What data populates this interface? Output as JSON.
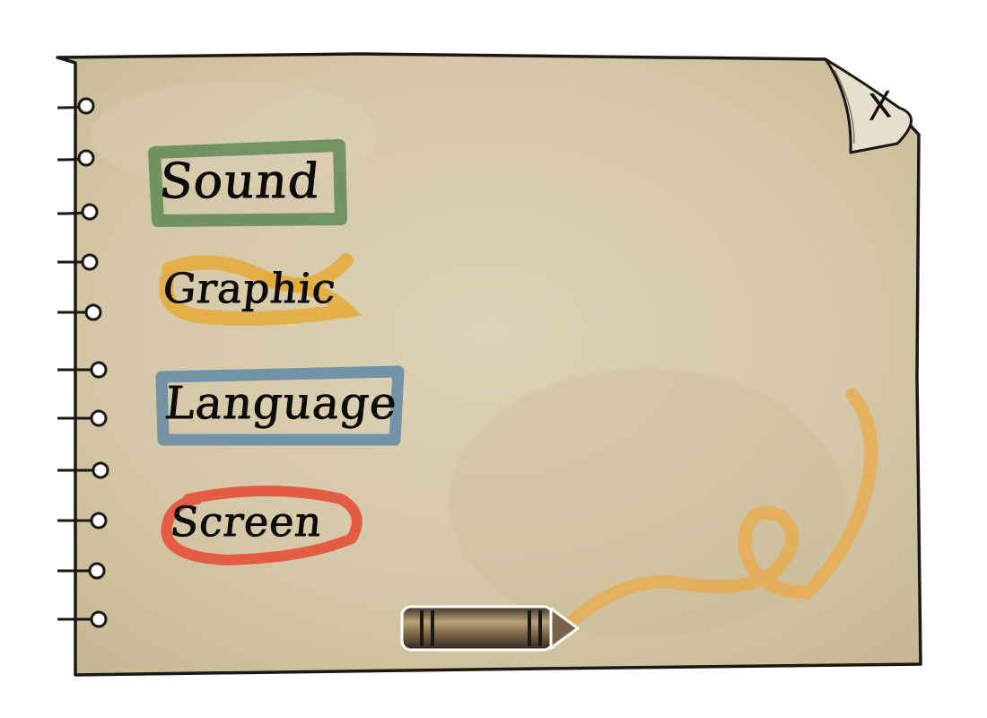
{
  "menu": {
    "items": [
      {
        "label": "Sound",
        "highlight": "green-box"
      },
      {
        "label": "Graphic",
        "highlight": "yellow-swoosh"
      },
      {
        "label": "Language",
        "highlight": "blue-box"
      },
      {
        "label": "Screen",
        "highlight": "red-oval"
      }
    ]
  },
  "close": {
    "label": "X"
  },
  "colors": {
    "paper": "#d8ccae",
    "paper_dark": "#c3b593",
    "ink": "#0c0b09",
    "sound_highlight": "#5f8a55",
    "graphic_highlight": "#e4aa3a",
    "language_highlight": "#5f8aa4",
    "screen_highlight": "#e7503a",
    "crayon_trail": "#e8aa48",
    "crayon_body": "#5a4a34"
  },
  "icons": {
    "close": "close-icon",
    "crayon": "crayon-icon",
    "spiral_binding": "notebook-ring-icon"
  }
}
